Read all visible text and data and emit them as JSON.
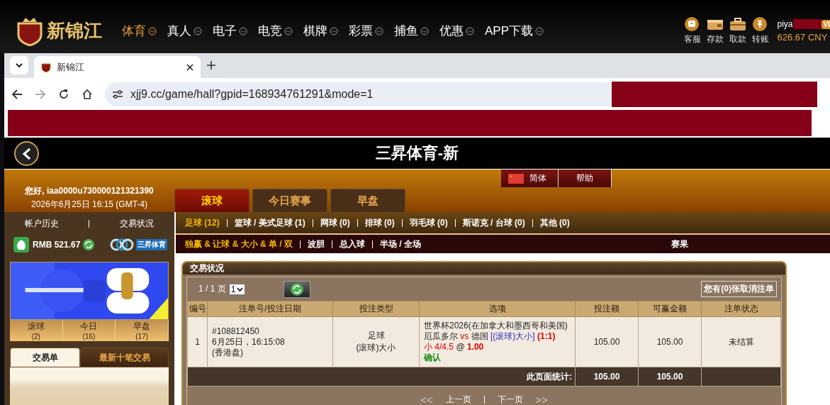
{
  "site_header": {
    "logo_text": "新锦江",
    "nav": [
      {
        "label": "体育",
        "selected": true
      },
      {
        "label": "真人",
        "selected": false
      },
      {
        "label": "电子",
        "selected": false
      },
      {
        "label": "电竞",
        "selected": false
      },
      {
        "label": "棋牌",
        "selected": false
      },
      {
        "label": "彩票",
        "selected": false
      },
      {
        "label": "捕鱼",
        "selected": false
      },
      {
        "label": "优惠",
        "selected": false
      },
      {
        "label": "APP下载",
        "selected": false
      }
    ],
    "actions": [
      "客服",
      "存款",
      "取款",
      "转账"
    ],
    "username": "piya",
    "vip_badge": "VI",
    "balance": "626.67 CNY"
  },
  "browser": {
    "tab_title": "新锦江",
    "url": "xjj9.cc/game/hall?gpid=168934761291&mode=1"
  },
  "page": {
    "title": "三昇体育-新",
    "language_tabs": [
      "简体",
      "帮助"
    ],
    "greeting": "您好, iaa0000u730000121321390",
    "datetime": "2026年6月25日 16:15 (GMT-4)",
    "market_tabs": [
      {
        "label": "滚球",
        "selected": true
      },
      {
        "label": "今日赛事",
        "selected": false
      },
      {
        "label": "早盘",
        "selected": false
      }
    ]
  },
  "sidebar": {
    "links": [
      "帐户历史",
      "交易状况"
    ],
    "balance": "RMB 521.67",
    "brand": "三昇体育",
    "counts": [
      {
        "label": "滚球",
        "count": "(2)"
      },
      {
        "label": "今日",
        "count": "(16)"
      },
      {
        "label": "早盘",
        "count": "(17)"
      }
    ],
    "tabs": [
      {
        "label": "交易单",
        "selected": true
      },
      {
        "label": "最新十笔交易",
        "selected": false
      }
    ]
  },
  "sports": [
    {
      "label": "足球 (12)",
      "selected": true
    },
    {
      "label": "篮球 / 美式足球 (1)",
      "selected": false
    },
    {
      "label": "网球 (0)",
      "selected": false
    },
    {
      "label": "排球 (0)",
      "selected": false
    },
    {
      "label": "羽毛球 (0)",
      "selected": false
    },
    {
      "label": "斯诺克 / 台球 (0)",
      "selected": false
    },
    {
      "label": "其他 (0)",
      "selected": false
    }
  ],
  "bet_types": [
    {
      "label": "独赢 & 让球 & 大小 & 单 / 双",
      "selected": true
    },
    {
      "label": "波胆",
      "selected": false
    },
    {
      "label": "总入球",
      "selected": false
    },
    {
      "label": "半场 / 全场",
      "selected": false
    }
  ],
  "results_link": "赛果",
  "panel": {
    "title": "交易状况",
    "page_info": "1 / 1 页",
    "page_select": "1",
    "cancelled_button": "您有(0)张取消注单",
    "columns": [
      "编号",
      "注单号/投注日期",
      "投注类型",
      "选项",
      "投注额",
      "可赢金额",
      "注单状态"
    ],
    "rows": [
      {
        "no": "1",
        "ticket": "#108812450",
        "date": "6月25日，16:15:08",
        "odds_type": "(香港盘)",
        "sport": "足球",
        "bet_type": "(滚球)大小",
        "league": "世界杯2026(在加拿大和墨西哥和美国)",
        "home": "厄瓜多尔",
        "vs": "vs",
        "away": "德国",
        "market": "[(滚球)大小]",
        "score": "(1:1)",
        "pick": "小 4/4.5",
        "at": "@",
        "odds": "1.00",
        "confirm": "确认",
        "stake": "105.00",
        "win": "105.00",
        "status": "未结算"
      }
    ],
    "total_label": "此页面统计:",
    "total_stake": "105.00",
    "total_win": "105.00",
    "pager": {
      "first": "<<",
      "prev": "上一页",
      "next": "下一页",
      "last": ">>"
    }
  }
}
